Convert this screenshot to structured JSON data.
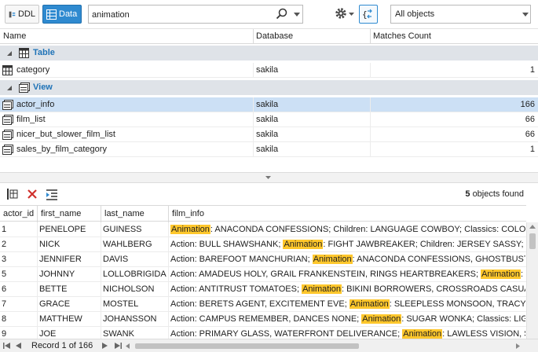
{
  "toolbar": {
    "ddl_label": "DDL",
    "data_label": "Data",
    "search_value": "animation",
    "scope_value": "All objects"
  },
  "results": {
    "columns": [
      "Name",
      "Database",
      "Matches Count"
    ],
    "groups": [
      {
        "label": "Table",
        "rows": [
          {
            "name": "category",
            "database": "sakila",
            "count": "1"
          }
        ]
      },
      {
        "label": "View",
        "rows": [
          {
            "name": "actor_info",
            "database": "sakila",
            "count": "166",
            "selected": true
          },
          {
            "name": "film_list",
            "database": "sakila",
            "count": "66"
          },
          {
            "name": "nicer_but_slower_film_list",
            "database": "sakila",
            "count": "66"
          },
          {
            "name": "sales_by_film_category",
            "database": "sakila",
            "count": "1"
          }
        ]
      }
    ]
  },
  "data_panel": {
    "found_count": "5",
    "found_suffix": "objects found",
    "columns": [
      "actor_id",
      "first_name",
      "last_name",
      "film_info"
    ],
    "rows": [
      {
        "actor_id": "1",
        "first_name": "PENELOPE",
        "last_name": "GUINESS",
        "film_info": "Animation: ANACONDA CONFESSIONS; Children: LANGUAGE COWBOY; Classics: COLOR PHILADELPHIA"
      },
      {
        "actor_id": "2",
        "first_name": "NICK",
        "last_name": "WAHLBERG",
        "film_info": "Action: BULL SHAWSHANK; Animation: FIGHT JAWBREAKER; Children: JERSEY SASSY; Classics: DRACULA"
      },
      {
        "actor_id": "3",
        "first_name": "JENNIFER",
        "last_name": "DAVIS",
        "film_info": "Action: BAREFOOT MANCHURIAN; Animation: ANACONDA CONFESSIONS, GHOSTBUSTERS ELF"
      },
      {
        "actor_id": "5",
        "first_name": "JOHNNY",
        "last_name": "LOLLOBRIGIDA",
        "film_info": "Action: AMADEUS HOLY, GRAIL FRANKENSTEIN, RINGS HEARTBREAKERS; Animation: SUNRISE"
      },
      {
        "actor_id": "6",
        "first_name": "BETTE",
        "last_name": "NICHOLSON",
        "film_info": "Action: ANTITRUST TOMATOES; Animation: BIKINI BORROWERS, CROSSROADS CASUALTIES"
      },
      {
        "actor_id": "7",
        "first_name": "GRACE",
        "last_name": "MOSTEL",
        "film_info": "Action: BERETS AGENT, EXCITEMENT EVE; Animation: SLEEPLESS MONSOON, TRACY CIDER; C"
      },
      {
        "actor_id": "8",
        "first_name": "MATTHEW",
        "last_name": "JOHANSSON",
        "film_info": "Action: CAMPUS REMEMBER, DANCES NONE; Animation: SUGAR WONKA; Classics: LIGHTS DEAL"
      },
      {
        "actor_id": "9",
        "first_name": "JOE",
        "last_name": "SWANK",
        "film_info": "Action: PRIMARY GLASS, WATERFRONT DELIVERANCE; Animation: LAWLESS VISION, SUNNY"
      }
    ],
    "highlight_term": "Animation"
  },
  "status": {
    "record_text": "Record 1 of 166"
  },
  "colors": {
    "accent": "#2f8ad0",
    "group_bg": "#dfe3e8",
    "group_text": "#1f73b7",
    "selected_row": "#cce0f5",
    "highlight": "#ffc72c"
  }
}
